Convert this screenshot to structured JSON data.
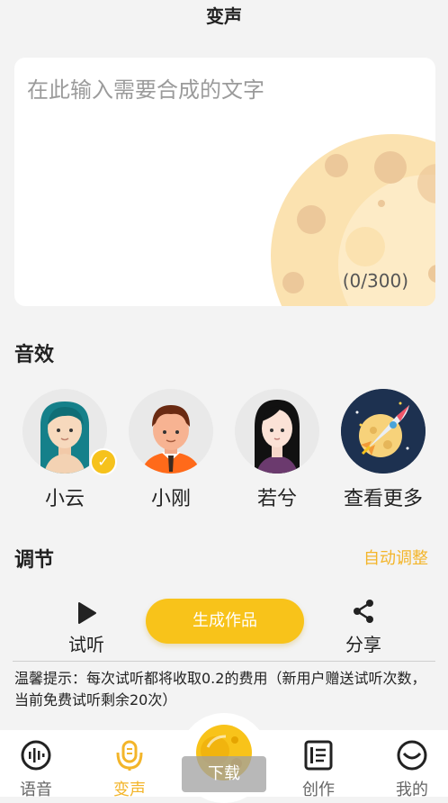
{
  "header": {
    "title": "变声"
  },
  "text_input": {
    "placeholder": "在此输入需要合成的文字",
    "counter": "(0/300)"
  },
  "sound_effects": {
    "title": "音效",
    "voices": [
      {
        "name": "小云",
        "selected": true
      },
      {
        "name": "小刚"
      },
      {
        "name": "若兮"
      },
      {
        "name": "查看更多"
      }
    ]
  },
  "adjust": {
    "title": "调节",
    "auto_label": "自动调整"
  },
  "actions": {
    "preview_label": "试听",
    "generate_label": "生成作品",
    "share_label": "分享"
  },
  "tip": "温馨提示：每次试听都将收取0.2的费用（新用户赠送试听次数，当前免费试听剩余20次）",
  "tabbar": {
    "tabs": [
      "语音",
      "变声",
      "下载",
      "创作",
      "我的"
    ],
    "active": "变声"
  },
  "colors": {
    "accent": "#f8c31a",
    "accent_text": "#f3b52a"
  }
}
